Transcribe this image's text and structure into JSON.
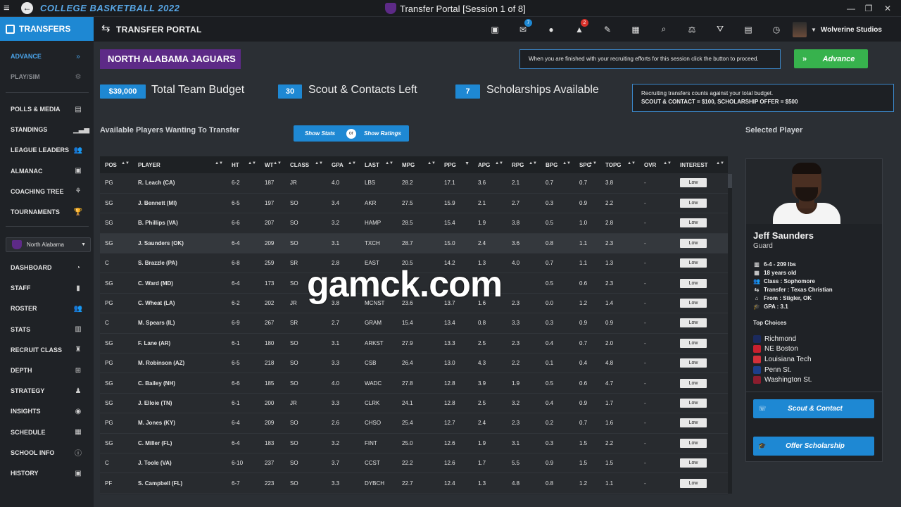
{
  "window": {
    "logo_text": "COLLEGE BASKETBALL 2022",
    "title": "Transfer Portal [Session 1 of 8]"
  },
  "sidebar": {
    "header": "TRANSFERS",
    "top_items": [
      {
        "label": "ADVANCE",
        "icon": "»"
      },
      {
        "label": "PLAY/SIM",
        "icon": "⚙"
      }
    ],
    "mid_items": [
      {
        "label": "POLLS & MEDIA",
        "icon": "▤"
      },
      {
        "label": "STANDINGS",
        "icon": "▁▃▅"
      },
      {
        "label": "LEAGUE LEADERS",
        "icon": "👥"
      },
      {
        "label": "ALMANAC",
        "icon": "▣"
      },
      {
        "label": "COACHING TREE",
        "icon": "⚘"
      },
      {
        "label": "TOURNAMENTS",
        "icon": "🏆"
      }
    ],
    "school_select": "North Alabama",
    "bottom_items": [
      {
        "label": "DASHBOARD",
        "icon": "◔"
      },
      {
        "label": "STAFF",
        "icon": "▮"
      },
      {
        "label": "ROSTER",
        "icon": "👥"
      },
      {
        "label": "STATS",
        "icon": "▥"
      },
      {
        "label": "RECRUIT CLASS",
        "icon": "♜"
      },
      {
        "label": "DEPTH",
        "icon": "⊞"
      },
      {
        "label": "STRATEGY",
        "icon": "♟"
      },
      {
        "label": "INSIGHTS",
        "icon": "◉"
      },
      {
        "label": "SCHEDULE",
        "icon": "▦"
      },
      {
        "label": "SCHOOL INFO",
        "icon": "ⓘ"
      },
      {
        "label": "HISTORY",
        "icon": "▣"
      }
    ]
  },
  "topbar": {
    "title": "TRANSFER PORTAL",
    "icons": [
      {
        "name": "briefcase",
        "glyph": "▣",
        "badge": ""
      },
      {
        "name": "mail",
        "glyph": "✉",
        "badge": "7"
      },
      {
        "name": "chat",
        "glyph": "●",
        "badge": ""
      },
      {
        "name": "bell",
        "glyph": "▲",
        "badge": "2"
      },
      {
        "name": "edit",
        "glyph": "✎",
        "badge": ""
      },
      {
        "name": "calendar-check",
        "glyph": "▦",
        "badge": ""
      },
      {
        "name": "search",
        "glyph": "⌕",
        "badge": ""
      },
      {
        "name": "scale",
        "glyph": "⚖",
        "badge": ""
      },
      {
        "name": "road",
        "glyph": "⛛",
        "badge": ""
      },
      {
        "name": "clipboard",
        "glyph": "▤",
        "badge": ""
      },
      {
        "name": "stopwatch",
        "glyph": "◷",
        "badge": ""
      }
    ],
    "user_name": "Wolverine Studios"
  },
  "main": {
    "team_name": "NORTH ALABAMA JAGUARS",
    "notice": "When you are finished with your recruiting efforts for this session click the button to proceed.",
    "advance_label": "Advance",
    "budget_value": "$39,000",
    "budget_label": "Total Team Budget",
    "scout_value": "30",
    "scout_label": "Scout & Contacts Left",
    "schol_value": "7",
    "schol_label": "Scholarships Available",
    "info_line1": "Recruiting transfers counts against your total budget.",
    "info_line2": "SCOUT & CONTACT = $100, SCHOLARSHIP OFFER = $500",
    "section_title": "Available Players Wanting To Transfer",
    "show_stats": "Show Stats",
    "or": "or",
    "show_ratings": "Show Ratings",
    "watermark": "gamck.com"
  },
  "table": {
    "headers": [
      "POS",
      "PLAYER",
      "HT",
      "WT",
      "CLASS",
      "GPA",
      "LAST",
      "MPG",
      "PPG",
      "APG",
      "RPG",
      "BPG",
      "SPG",
      "TOPG",
      "OVR",
      "INTEREST"
    ],
    "rows": [
      [
        "PG",
        "R. Leach (CA)",
        "6-2",
        "187",
        "JR",
        "4.0",
        "LBS",
        "28.2",
        "17.1",
        "3.6",
        "2.1",
        "0.7",
        "0.7",
        "3.8",
        "-",
        "Low"
      ],
      [
        "SG",
        "J. Bennett (MI)",
        "6-5",
        "197",
        "SO",
        "3.4",
        "AKR",
        "27.5",
        "15.9",
        "2.1",
        "2.7",
        "0.3",
        "0.9",
        "2.2",
        "-",
        "Low"
      ],
      [
        "SG",
        "B. Phillips (VA)",
        "6-6",
        "207",
        "SO",
        "3.2",
        "HAMP",
        "28.5",
        "15.4",
        "1.9",
        "3.8",
        "0.5",
        "1.0",
        "2.8",
        "-",
        "Low"
      ],
      [
        "SG",
        "J. Saunders (OK)",
        "6-4",
        "209",
        "SO",
        "3.1",
        "TXCH",
        "28.7",
        "15.0",
        "2.4",
        "3.6",
        "0.8",
        "1.1",
        "2.3",
        "-",
        "Low"
      ],
      [
        "C",
        "S. Brazzle (PA)",
        "6-8",
        "259",
        "SR",
        "2.8",
        "EAST",
        "20.5",
        "14.2",
        "1.3",
        "4.0",
        "0.7",
        "1.1",
        "1.3",
        "-",
        "Low"
      ],
      [
        "SG",
        "C. Ward (MD)",
        "6-4",
        "173",
        "SO",
        "",
        "",
        "",
        "",
        "",
        "",
        "0.5",
        "0.6",
        "2.3",
        "-",
        "Low"
      ],
      [
        "PG",
        "C. Wheat (LA)",
        "6-2",
        "202",
        "JR",
        "3.8",
        "MCNST",
        "23.6",
        "13.7",
        "1.6",
        "2.3",
        "0.0",
        "1.2",
        "1.4",
        "-",
        "Low"
      ],
      [
        "C",
        "M. Spears (IL)",
        "6-9",
        "267",
        "SR",
        "2.7",
        "GRAM",
        "15.4",
        "13.4",
        "0.8",
        "3.3",
        "0.3",
        "0.9",
        "0.9",
        "-",
        "Low"
      ],
      [
        "SG",
        "F. Lane (AR)",
        "6-1",
        "180",
        "SO",
        "3.1",
        "ARKST",
        "27.9",
        "13.3",
        "2.5",
        "2.3",
        "0.4",
        "0.7",
        "2.0",
        "-",
        "Low"
      ],
      [
        "PG",
        "M. Robinson (AZ)",
        "6-5",
        "218",
        "SO",
        "3.3",
        "CSB",
        "26.4",
        "13.0",
        "4.3",
        "2.2",
        "0.1",
        "0.4",
        "4.8",
        "-",
        "Low"
      ],
      [
        "SG",
        "C. Bailey (NH)",
        "6-6",
        "185",
        "SO",
        "4.0",
        "WADC",
        "27.8",
        "12.8",
        "3.9",
        "1.9",
        "0.5",
        "0.6",
        "4.7",
        "-",
        "Low"
      ],
      [
        "SG",
        "J. Elloie (TN)",
        "6-1",
        "200",
        "JR",
        "3.3",
        "CLRK",
        "24.1",
        "12.8",
        "2.5",
        "3.2",
        "0.4",
        "0.9",
        "1.7",
        "-",
        "Low"
      ],
      [
        "PG",
        "M. Jones (KY)",
        "6-4",
        "209",
        "SO",
        "2.6",
        "CHSO",
        "25.4",
        "12.7",
        "2.4",
        "2.3",
        "0.2",
        "0.7",
        "1.6",
        "-",
        "Low"
      ],
      [
        "SG",
        "C. Miller (FL)",
        "6-4",
        "183",
        "SO",
        "3.2",
        "FINT",
        "25.0",
        "12.6",
        "1.9",
        "3.1",
        "0.3",
        "1.5",
        "2.2",
        "-",
        "Low"
      ],
      [
        "C",
        "J. Toole (VA)",
        "6-10",
        "237",
        "SO",
        "3.7",
        "CCST",
        "22.2",
        "12.6",
        "1.7",
        "5.5",
        "0.9",
        "1.5",
        "1.5",
        "-",
        "Low"
      ],
      [
        "PF",
        "S. Campbell (FL)",
        "6-7",
        "223",
        "SO",
        "3.3",
        "DYBCH",
        "22.7",
        "12.4",
        "1.3",
        "4.8",
        "0.8",
        "1.2",
        "1.1",
        "-",
        "Low"
      ]
    ],
    "highlight_row": 3
  },
  "selected_player": {
    "section_title": "Selected Player",
    "name": "Jeff Saunders",
    "position": "Guard",
    "details": [
      {
        "icon": "▥",
        "text": "6-4 - 209 lbs"
      },
      {
        "icon": "▦",
        "text": "18 years old"
      },
      {
        "icon": "👥",
        "text": "Class : Sophomore"
      },
      {
        "icon": "⇆",
        "text": "Transfer : Texas Christian"
      },
      {
        "icon": "⌂",
        "text": "From : Stigler, OK"
      },
      {
        "icon": "🎓",
        "text": "GPA : 3.1"
      }
    ],
    "top_choices_title": "Top Choices",
    "top_choices": [
      {
        "name": "Richmond",
        "color": "#1b2a5e"
      },
      {
        "name": "NE Boston",
        "color": "#c8202f"
      },
      {
        "name": "Louisiana Tech",
        "color": "#d3303a"
      },
      {
        "name": "Penn St.",
        "color": "#1c3e8a"
      },
      {
        "name": "Washington St.",
        "color": "#8c1d2e"
      }
    ],
    "scout_label": "Scout & Contact",
    "offer_label": "Offer Scholarship"
  },
  "colors": {
    "accent": "#1e88d3",
    "team": "#5d2a87",
    "advance": "#37b24d"
  }
}
